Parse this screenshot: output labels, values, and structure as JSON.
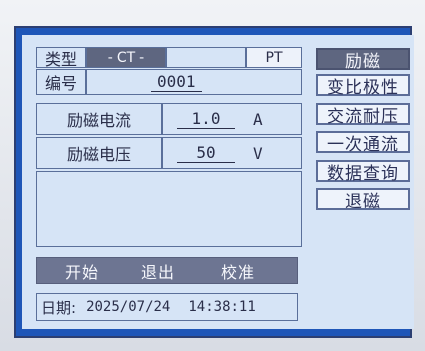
{
  "header": {
    "type_label": "类型",
    "ct_label": "CT",
    "pt_label": "PT",
    "number_label": "编号",
    "number_value": "0001"
  },
  "params": {
    "current_label": "励磁电流",
    "current_value": "1.0",
    "current_unit": "A",
    "voltage_label": "励磁电压",
    "voltage_value": "50",
    "voltage_unit": "V"
  },
  "menu": {
    "items": [
      {
        "label": "励磁",
        "active": true
      },
      {
        "label": "变比极性",
        "active": false
      },
      {
        "label": "交流耐压",
        "active": false
      },
      {
        "label": "一次通流",
        "active": false
      },
      {
        "label": "数据查询",
        "active": false
      },
      {
        "label": "退磁",
        "active": false
      }
    ]
  },
  "actions": {
    "start": "开始",
    "exit": "退出",
    "calibrate": "校准"
  },
  "status": {
    "date_label": "日期:",
    "date": "2025/07/24",
    "time": "14:38:11"
  },
  "colors": {
    "screen_border": "#1e56b8",
    "panel": "#d6e4f6",
    "active_button": "#5e6680"
  }
}
